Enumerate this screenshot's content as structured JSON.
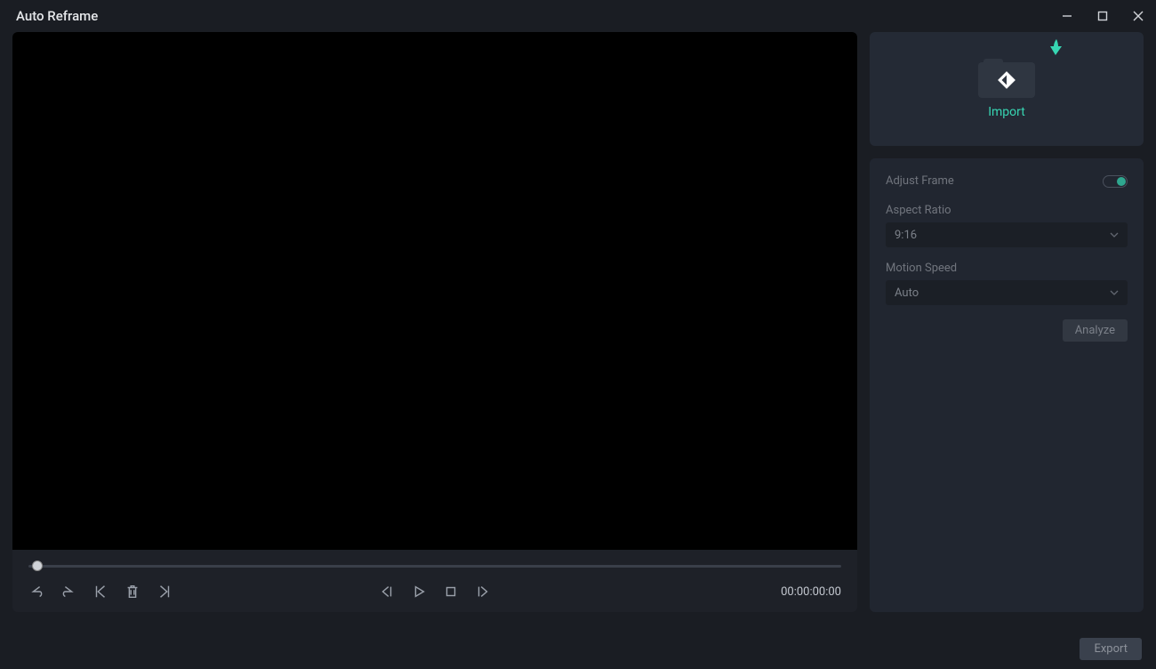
{
  "window": {
    "title": "Auto Reframe"
  },
  "import": {
    "label": "Import"
  },
  "settings": {
    "adjust_frame_label": "Adjust Frame",
    "adjust_frame_on": true,
    "aspect_ratio_label": "Aspect Ratio",
    "aspect_ratio_value": "9:16",
    "motion_speed_label": "Motion Speed",
    "motion_speed_value": "Auto",
    "analyze_label": "Analyze"
  },
  "player": {
    "timecode": "00:00:00:00"
  },
  "footer": {
    "export_label": "Export"
  }
}
